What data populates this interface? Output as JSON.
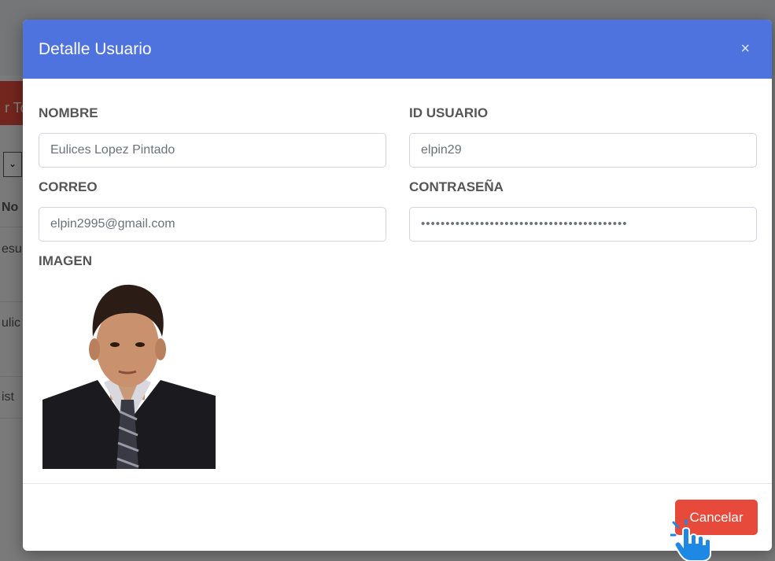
{
  "background": {
    "red_button_fragment": "r To",
    "cells": [
      "No",
      "esu",
      "ulic",
      "ist"
    ]
  },
  "modal": {
    "title": "Detalle Usuario",
    "close_glyph": "×",
    "fields": {
      "nombre": {
        "label": "NOMBRE",
        "value": "Eulices Lopez Pintado"
      },
      "id_usuario": {
        "label": "ID USUARIO",
        "value": "elpin29"
      },
      "correo": {
        "label": "CORREO",
        "value": "elpin2995@gmail.com"
      },
      "contrasena": {
        "label": "CONTRASEÑA",
        "value": "••••••••••••••••••••••••••••••••••••••••••"
      }
    },
    "image_label": "IMAGEN",
    "cancel_label": "Cancelar"
  },
  "colors": {
    "header": "#4e73df",
    "cancel": "#e74a3b",
    "cursor": "#1e88e5"
  },
  "icons": [
    "close-icon",
    "hand-pointer-icon"
  ]
}
